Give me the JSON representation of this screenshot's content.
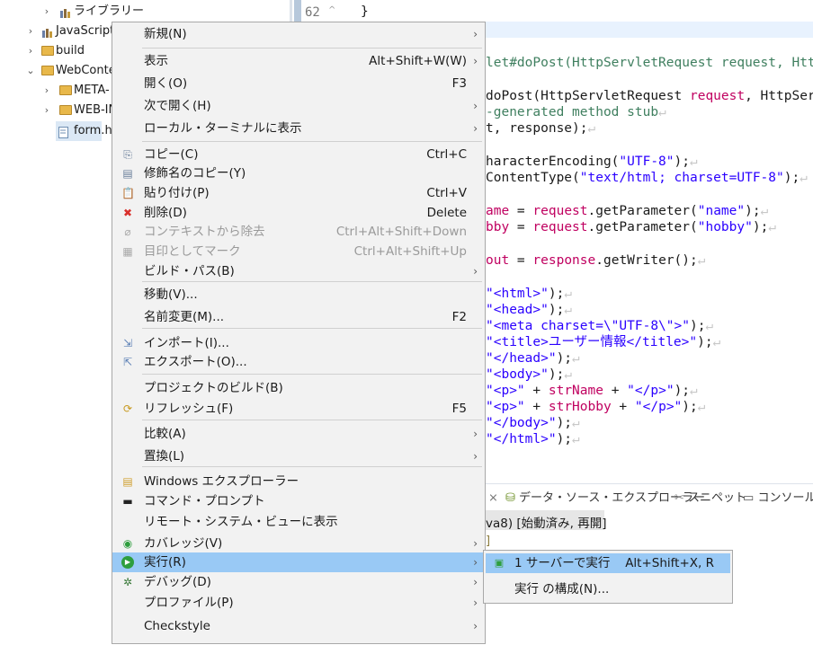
{
  "explorer": {
    "items": [
      {
        "label": "ライブラリー",
        "arrow": "›",
        "icon": "library-icon"
      },
      {
        "label": "JavaScript",
        "arrow": "›",
        "icon": "library-icon"
      },
      {
        "label": "build",
        "arrow": "›",
        "icon": "folder-icon"
      },
      {
        "label": "WebConte",
        "arrow": "⌄",
        "icon": "folder-icon"
      },
      {
        "label": "META-",
        "arrow": "›",
        "icon": "folder-icon"
      },
      {
        "label": "WEB-IN",
        "arrow": "›",
        "icon": "folder-icon"
      },
      {
        "label": "form.h",
        "arrow": "",
        "icon": "html-file-icon"
      }
    ]
  },
  "editor": {
    "line_number": "62",
    "closing_brace": "}",
    "line_marker": "↵"
  },
  "views": {
    "tabs": [
      {
        "label": "データ・ソース・エクスプローラー",
        "icon": "datasource-icon"
      },
      {
        "label": "スニペット",
        "icon": "snippet-icon"
      },
      {
        "label": "コンソール",
        "icon": "console-icon"
      }
    ],
    "server_status": "va8)  [始動済み, 再開]",
    "server_sub": "]"
  },
  "context_menu": {
    "items": [
      {
        "label": "新規(N)",
        "accel": "",
        "submenu": true,
        "icon": "",
        "disabled": false
      },
      {
        "label": "表示",
        "accel": "Alt+Shift+W(W)",
        "submenu": true,
        "icon": "",
        "disabled": false
      },
      {
        "label": "開く(O)",
        "accel": "F3",
        "submenu": false,
        "icon": "",
        "disabled": false
      },
      {
        "label": "次で開く(H)",
        "accel": "",
        "submenu": true,
        "icon": "",
        "disabled": false
      },
      {
        "label": "ローカル・ターミナルに表示",
        "accel": "",
        "submenu": true,
        "icon": "",
        "disabled": false
      },
      {
        "label": "コピー(C)",
        "accel": "Ctrl+C",
        "submenu": false,
        "icon": "copy-icon",
        "disabled": false
      },
      {
        "label": "修飾名のコピー(Y)",
        "accel": "",
        "submenu": false,
        "icon": "copy-qualified-name-icon",
        "disabled": false
      },
      {
        "label": "貼り付け(P)",
        "accel": "Ctrl+V",
        "submenu": false,
        "icon": "paste-icon",
        "disabled": false
      },
      {
        "label": "削除(D)",
        "accel": "Delete",
        "submenu": false,
        "icon": "delete-icon",
        "disabled": false
      },
      {
        "label": "コンテキストから除去",
        "accel": "Ctrl+Alt+Shift+Down",
        "submenu": false,
        "icon": "remove-context-icon",
        "disabled": true
      },
      {
        "label": "目印としてマーク",
        "accel": "Ctrl+Alt+Shift+Up",
        "submenu": false,
        "icon": "mark-icon",
        "disabled": true
      },
      {
        "label": "ビルド・パス(B)",
        "accel": "",
        "submenu": true,
        "icon": "",
        "disabled": false
      },
      {
        "label": "移動(V)...",
        "accel": "",
        "submenu": false,
        "icon": "",
        "disabled": false
      },
      {
        "label": "名前変更(M)...",
        "accel": "F2",
        "submenu": false,
        "icon": "",
        "disabled": false
      },
      {
        "label": "インポート(I)...",
        "accel": "",
        "submenu": false,
        "icon": "import-icon",
        "disabled": false
      },
      {
        "label": "エクスポート(O)...",
        "accel": "",
        "submenu": false,
        "icon": "export-icon",
        "disabled": false
      },
      {
        "label": "プロジェクトのビルド(B)",
        "accel": "",
        "submenu": false,
        "icon": "",
        "disabled": false
      },
      {
        "label": "リフレッシュ(F)",
        "accel": "F5",
        "submenu": false,
        "icon": "refresh-icon",
        "disabled": false
      },
      {
        "label": "比較(A)",
        "accel": "",
        "submenu": true,
        "icon": "",
        "disabled": false
      },
      {
        "label": "置換(L)",
        "accel": "",
        "submenu": true,
        "icon": "",
        "disabled": false
      },
      {
        "label": "Windows エクスプローラー",
        "accel": "",
        "submenu": false,
        "icon": "windows-explorer-icon",
        "disabled": false
      },
      {
        "label": "コマンド・プロンプト",
        "accel": "",
        "submenu": false,
        "icon": "command-prompt-icon",
        "disabled": false
      },
      {
        "label": "リモート・システム・ビューに表示",
        "accel": "",
        "submenu": false,
        "icon": "",
        "disabled": false
      },
      {
        "label": "カバレッジ(V)",
        "accel": "",
        "submenu": true,
        "icon": "coverage-icon",
        "disabled": false
      },
      {
        "label": "実行(R)",
        "accel": "",
        "submenu": true,
        "icon": "run-icon",
        "disabled": false,
        "highlighted": true
      },
      {
        "label": "デバッグ(D)",
        "accel": "",
        "submenu": true,
        "icon": "debug-icon",
        "disabled": false
      },
      {
        "label": "プロファイル(P)",
        "accel": "",
        "submenu": true,
        "icon": "",
        "disabled": false
      },
      {
        "label": "Checkstyle",
        "accel": "",
        "submenu": true,
        "icon": "",
        "disabled": false
      }
    ]
  },
  "run_submenu": {
    "items": [
      {
        "label": "1 サーバーで実行",
        "accel": "Alt+Shift+X, R",
        "icon": "run-on-server-icon",
        "highlighted": true
      },
      {
        "label": "実行 の構成(N)...",
        "accel": "",
        "icon": "",
        "highlighted": false
      }
    ]
  }
}
